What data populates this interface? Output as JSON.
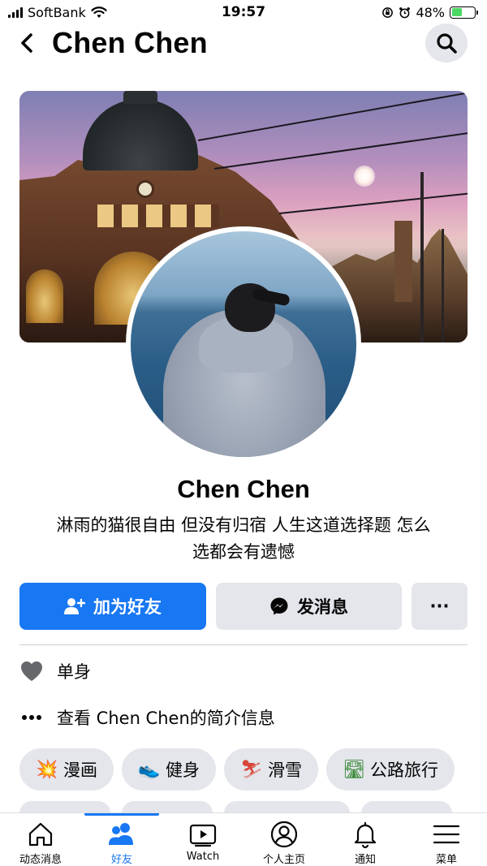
{
  "status_bar": {
    "carrier": "SoftBank",
    "time": "19:57",
    "battery": "48%",
    "battery_level": 0.48,
    "icons": [
      "signal-icon",
      "wifi-icon",
      "orientation-lock-icon",
      "alarm-icon",
      "battery-charging-icon"
    ]
  },
  "header": {
    "title": "Chen Chen",
    "back_icon": "chevron-left-icon",
    "search_icon": "search-icon"
  },
  "profile": {
    "name": "Chen Chen",
    "bio_line1": "淋雨的猫很自由 但没有归宿 人生这道选择题 怎么",
    "bio_line2": "选都会有遗憾"
  },
  "actions": {
    "add_friend": "加为好友",
    "message": "发消息",
    "more": "···"
  },
  "info": {
    "relationship": "单身",
    "about": "查看 Chen Chen的简介信息"
  },
  "hobbies": [
    {
      "emoji": "💥",
      "label": "漫画"
    },
    {
      "emoji": "👟",
      "label": "健身"
    },
    {
      "emoji": "⛷",
      "label": "滑雪"
    },
    {
      "emoji": "🛣",
      "label": "公路旅行"
    }
  ],
  "tabs": [
    {
      "label": "动态消息",
      "icon": "home-icon"
    },
    {
      "label": "好友",
      "icon": "friends-icon",
      "active": true
    },
    {
      "label": "Watch",
      "icon": "watch-video-icon"
    },
    {
      "label": "个人主页",
      "icon": "profile-icon"
    },
    {
      "label": "通知",
      "icon": "bell-icon"
    },
    {
      "label": "菜单",
      "icon": "menu-icon"
    }
  ],
  "colors": {
    "primary": "#1877f2",
    "secondary_bg": "#e4e6eb",
    "text": "#050505",
    "battery_green": "#4cd964"
  }
}
